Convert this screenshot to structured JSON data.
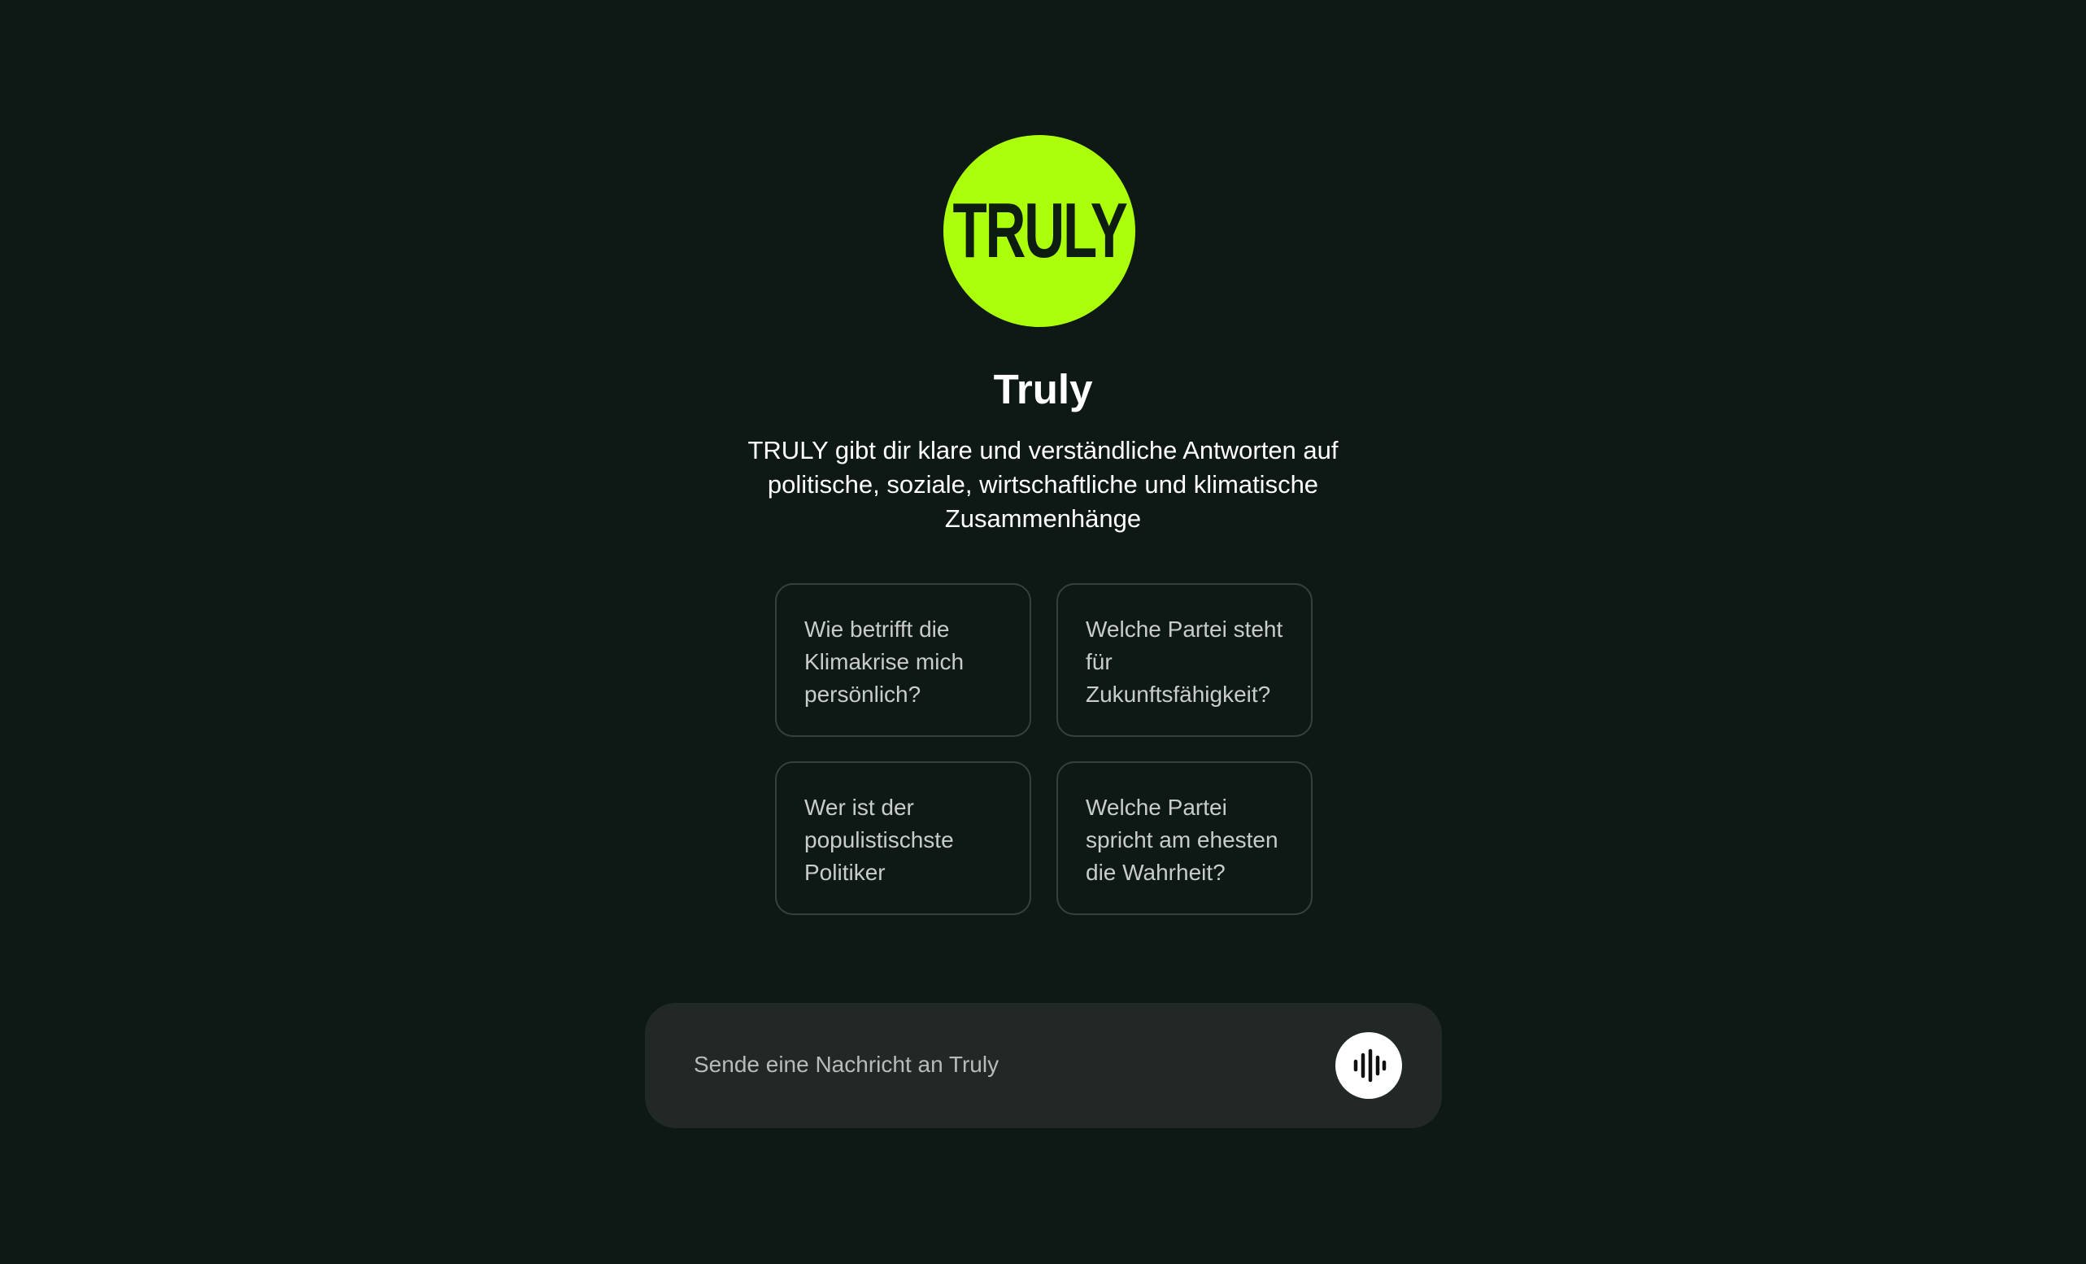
{
  "logo": {
    "text": "TRULY",
    "color": "#abff0b"
  },
  "header": {
    "title": "Truly",
    "description": "TRULY gibt dir klare und verständliche Antworten auf politische, soziale, wirtschaftliche und klimatische Zusammenhänge"
  },
  "suggestions": [
    {
      "label": "Wie betrifft die Klimakrise mich persönlich?"
    },
    {
      "label": "Welche Partei steht für Zukunftsfähigkeit?"
    },
    {
      "label": "Wer ist der populistischste Politiker"
    },
    {
      "label": "Welche Partei spricht am ehesten die Wahrheit?"
    }
  ],
  "composer": {
    "value": "",
    "placeholder": "Sende eine Nachricht an Truly",
    "voice_icon": "audio-waveform-icon"
  },
  "colors": {
    "background": "#0e1916",
    "accent": "#abff0b",
    "card_border": "#36403d",
    "composer_background": "#222826"
  }
}
